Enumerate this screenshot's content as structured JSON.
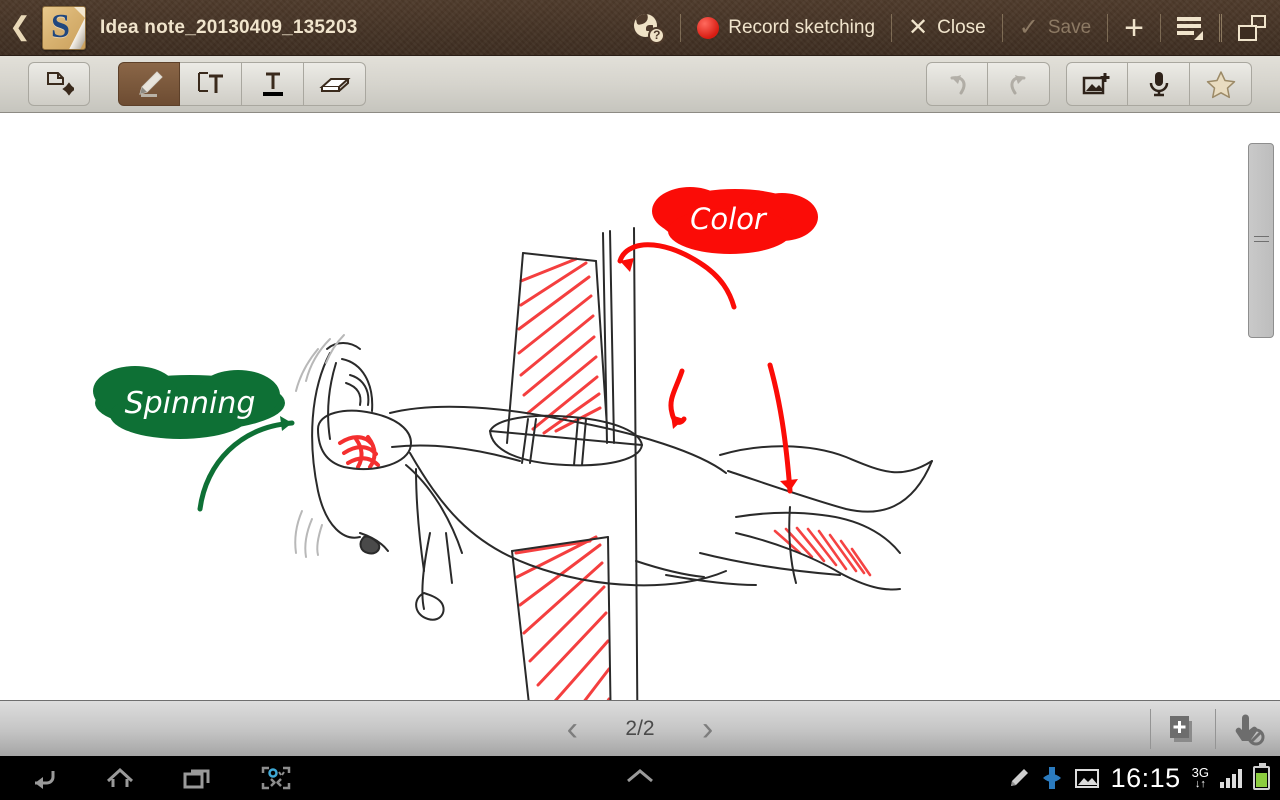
{
  "titlebar": {
    "back_icon": "chevron-left-icon",
    "app_icon": "s-note-app-icon",
    "app_letter": "S",
    "document_title": "Idea note_20130409_135203",
    "help_icon": "globe-help-icon",
    "help_badge": "?",
    "record_label": "Record sketching",
    "close_label": "Close",
    "close_icon": "✕",
    "save_label": "Save",
    "save_icon": "✓",
    "add_icon": "+",
    "menu_icon": "list-menu-icon",
    "multiwindow_icon": "multi-window-icon",
    "bg_color": "#4e3a2b",
    "text_color": "#f0e4cc",
    "record_dot_color": "#d81c12",
    "save_disabled_color": "#8d7a64"
  },
  "toolbar": {
    "left_tools": [
      {
        "name": "selection-move-tool",
        "icon": "shape-move-icon",
        "active": false
      },
      {
        "name": "pen-tool",
        "icon": "pen-icon",
        "active": true
      },
      {
        "name": "text-box-tool",
        "icon": "text-box-icon",
        "active": false
      },
      {
        "name": "text-tool",
        "icon": "text-underline-icon",
        "active": false
      },
      {
        "name": "eraser-tool",
        "icon": "eraser-icon",
        "active": false
      }
    ],
    "right_tools": [
      {
        "name": "undo-button",
        "icon": "undo-arrow-icon",
        "disabled": true
      },
      {
        "name": "redo-button",
        "icon": "redo-arrow-icon",
        "disabled": true
      },
      {
        "name": "insert-image-button",
        "icon": "image-plus-icon",
        "disabled": false
      },
      {
        "name": "voice-record-button",
        "icon": "microphone-icon",
        "disabled": false
      },
      {
        "name": "favorite-button",
        "icon": "star-icon",
        "disabled": false
      }
    ],
    "active_color": "#6d4c32",
    "bg_color": "#d6d4cd"
  },
  "canvas": {
    "background": "#ffffff",
    "scrollbar": {
      "name": "vertical-scrollbar",
      "grip_icon": "grip-lines-icon"
    },
    "annotations": [
      {
        "name": "spinning-label",
        "text": "Spinning",
        "color": "#0e7035",
        "text_color": "#ffffff"
      },
      {
        "name": "color-label",
        "text": "Color",
        "color": "#fb0c07",
        "text_color": "#ffffff"
      }
    ],
    "sketch": {
      "subject": "airplane-sketch",
      "ink_color": "#1c1c1c",
      "highlight_color": "#f42f2f"
    }
  },
  "pagebar": {
    "prev_icon": "‹",
    "next_icon": "›",
    "page_indicator": "2/2",
    "add_page_icon": "add-page-icon",
    "palm_reject_icon": "palm-rejection-icon"
  },
  "navbar": {
    "back_icon": "android-back-icon",
    "home_icon": "android-home-icon",
    "recents_icon": "android-recents-icon",
    "screenshot_icon": "screen-capture-icon",
    "expand_icon": "chevron-up-icon",
    "status": {
      "pen_icon": "stylus-icon",
      "sync_icon": "share-sync-icon",
      "image_icon": "screenshot-saved-icon",
      "clock": "16:15",
      "network": "3G",
      "network_arrows": "↓↑",
      "signal_icon": "signal-bars-icon",
      "battery_icon": "battery-icon",
      "battery_color": "#8ccc3f"
    }
  }
}
